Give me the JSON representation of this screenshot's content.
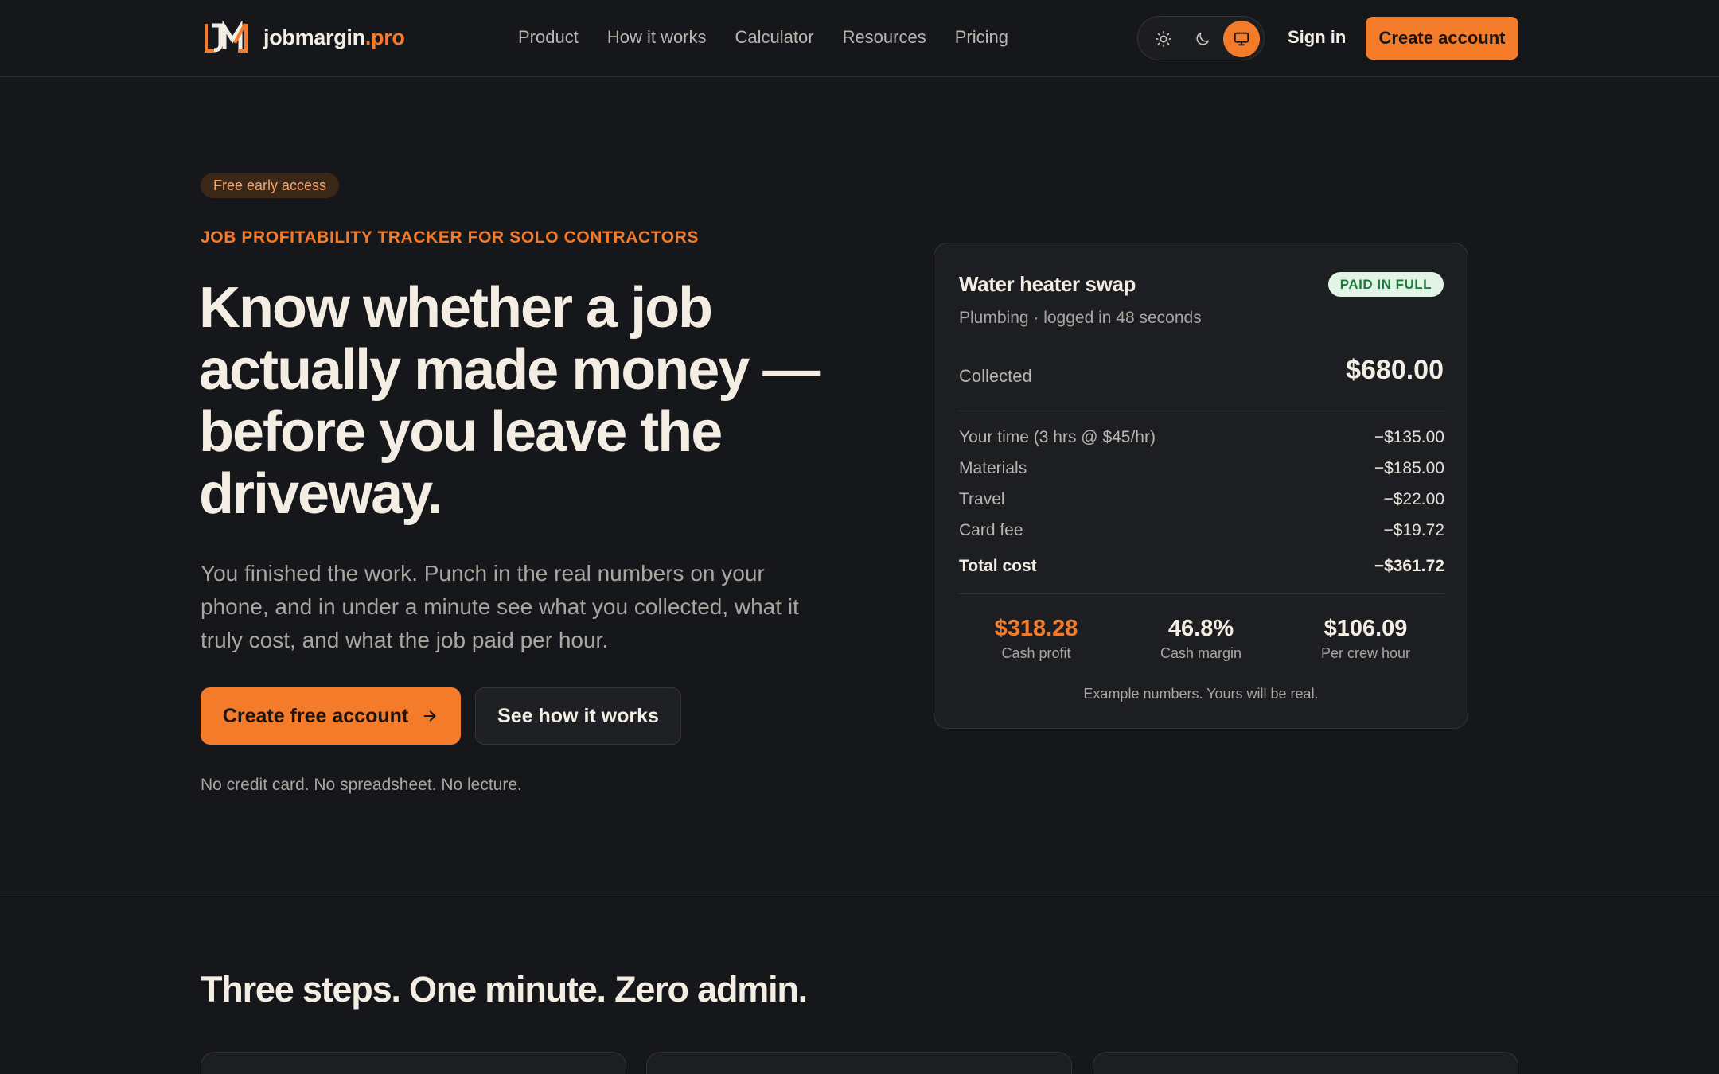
{
  "brand": {
    "name": "jobmargin",
    "tld": ".pro",
    "accent": "#f47b2a",
    "background": "#16171a"
  },
  "nav": {
    "links": [
      "Product",
      "How it works",
      "Calculator",
      "Resources",
      "Pricing"
    ],
    "theme_icons": [
      "sun-icon",
      "moon-icon",
      "monitor-icon"
    ],
    "theme_active": "monitor",
    "signin": "Sign in",
    "create_account": "Create account"
  },
  "hero": {
    "badge": "Free early access",
    "eyebrow": "JOB PROFITABILITY TRACKER FOR SOLO CONTRACTORS",
    "headline": "Know whether a job actually made money — before you leave the driveway.",
    "subtext": "You finished the work. Punch in the real numbers on your phone, and in under a minute see what you collected, what it truly cost, and what the job paid per hour.",
    "cta_primary": "Create free account",
    "cta_secondary": "See how it works",
    "fineprint": "No credit card. No spreadsheet. No lecture."
  },
  "job_card": {
    "title": "Water heater swap",
    "status": "PAID IN FULL",
    "subtitle": "Plumbing · logged in 48 seconds",
    "collected_label": "Collected",
    "collected_value": "$680.00",
    "costs": [
      {
        "label": "Your time (3 hrs @ $45/hr)",
        "amount": "−$135.00"
      },
      {
        "label": "Materials",
        "amount": "−$185.00"
      },
      {
        "label": "Travel",
        "amount": "−$22.00"
      },
      {
        "label": "Card fee",
        "amount": "−$19.72"
      }
    ],
    "total_label": "Total cost",
    "total_amount": "−$361.72",
    "stats": [
      {
        "value": "$318.28",
        "label": "Cash profit"
      },
      {
        "value": "46.8%",
        "label": "Cash margin"
      },
      {
        "value": "$106.09",
        "label": "Per crew hour"
      }
    ],
    "note": "Example numbers. Yours will be real."
  },
  "steps_section": {
    "title": "Three steps. One minute. Zero admin."
  }
}
